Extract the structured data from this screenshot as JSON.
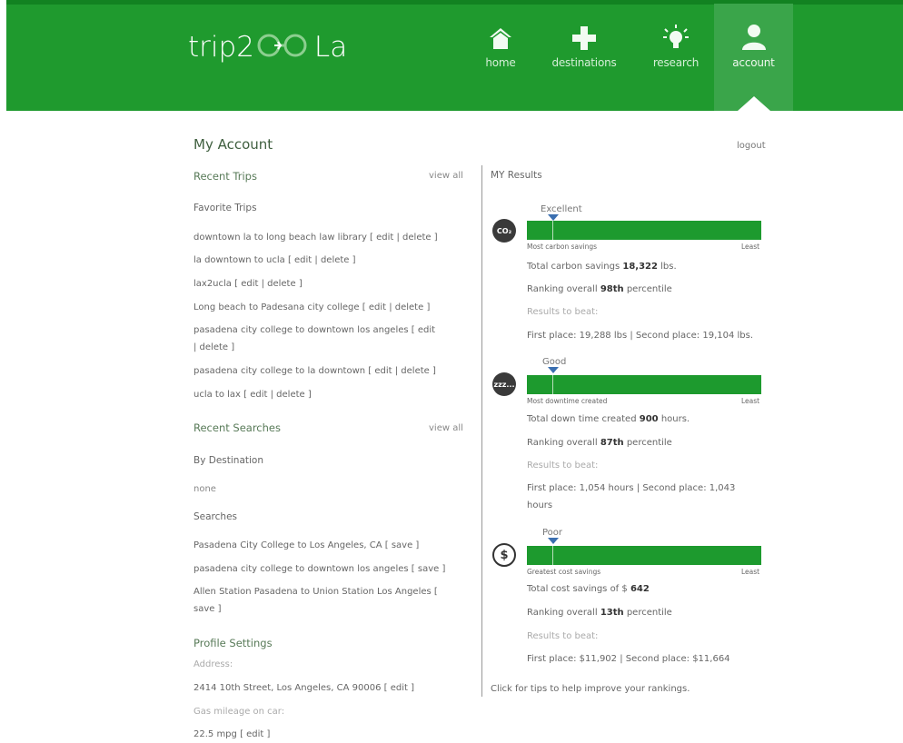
{
  "header": {
    "logo": {
      "pre": "trip2",
      "post": "La"
    },
    "nav": [
      {
        "label": "home",
        "icon": "home-icon"
      },
      {
        "label": "destinations",
        "icon": "plus-icon"
      },
      {
        "label": "research",
        "icon": "lightbulb-icon"
      },
      {
        "label": "account",
        "icon": "user-icon"
      }
    ],
    "active": "account",
    "colors": {
      "brand": "#1f9a2e",
      "active": "#3aa54a"
    }
  },
  "page": {
    "title": "My Account",
    "logout": "logout"
  },
  "left": {
    "recent_trips": {
      "heading": "Recent Trips",
      "view_all": "view all",
      "favorites_label": "Favorite Trips",
      "items": [
        {
          "text": "downtown la to long beach law library",
          "actions": "[ edit | delete ]"
        },
        {
          "text": "la downtown to ucla",
          "actions": "[ edit | delete ]"
        },
        {
          "text": "lax2ucla",
          "actions": "[ edit | delete ]"
        },
        {
          "text": "Long beach to Padesana city college",
          "actions": "[ edit | delete ]"
        },
        {
          "text": "pasadena city college to downtown los angeles",
          "actions": "[ edit | delete ]"
        },
        {
          "text": "pasadena city college to la downtown",
          "actions": "[ edit | delete ]"
        },
        {
          "text": "ucla to lax",
          "actions": "[ edit | delete ]"
        }
      ]
    },
    "recent_searches": {
      "heading": "Recent Searches",
      "view_all": "view all",
      "by_destination_label": "By Destination",
      "by_destination_value": "none",
      "searches_label": "Searches",
      "items": [
        {
          "text": "Pasadena City College to Los Angeles, CA",
          "actions": "[ save ]"
        },
        {
          "text": "pasadena city college to downtown los angeles",
          "actions": "[ save ]"
        },
        {
          "text": "Allen Station Pasadena to Union Station Los Angeles",
          "actions": "[ save ]"
        }
      ]
    },
    "profile": {
      "heading": "Profile Settings",
      "address_label": "Address:",
      "address_value": "2414 10th Street, Los Angeles, CA 90006",
      "address_action": "[ edit ]",
      "mileage_label": "Gas mileage on car:",
      "mileage_value": "22.5 mpg",
      "mileage_action": "[ edit ]"
    }
  },
  "results": {
    "heading": "MY Results",
    "footer": "Click for tips to help improve your rankings.",
    "beat_label": "Results to beat:",
    "items": [
      {
        "icon": "co2-icon",
        "icon_text": "CO₂",
        "level": "Excellent",
        "marker_pct": 11,
        "left_label": "Most carbon savings",
        "right_label": "Least",
        "total_pre": "Total carbon savings",
        "total_value": "18,322",
        "total_post": "lbs.",
        "rank_pre": "Ranking overall",
        "rank_value": "98th",
        "rank_post": "percentile",
        "beat": "First place: 19,288 lbs | Second place: 19,104 lbs."
      },
      {
        "icon": "sleep-icon",
        "icon_text": "zzz...",
        "level": "Good",
        "marker_pct": 11,
        "left_label": "Most downtime created",
        "right_label": "Least",
        "total_pre": "Total down time created",
        "total_value": "900",
        "total_post": "hours.",
        "rank_pre": "Ranking overall",
        "rank_value": "87th",
        "rank_post": "percentile",
        "beat": "First place: 1,054 hours | Second place: 1,043 hours"
      },
      {
        "icon": "dollar-icon",
        "icon_text": "$",
        "level": "Poor",
        "marker_pct": 11,
        "left_label": "Greatest cost savings",
        "right_label": "Least",
        "total_pre": "Total cost savings of $",
        "total_value": "642",
        "total_post": "",
        "rank_pre": "Ranking overall",
        "rank_value": "13th",
        "rank_post": "percentile",
        "beat": "First place: $11,902 | Second place: $11,664"
      }
    ]
  }
}
